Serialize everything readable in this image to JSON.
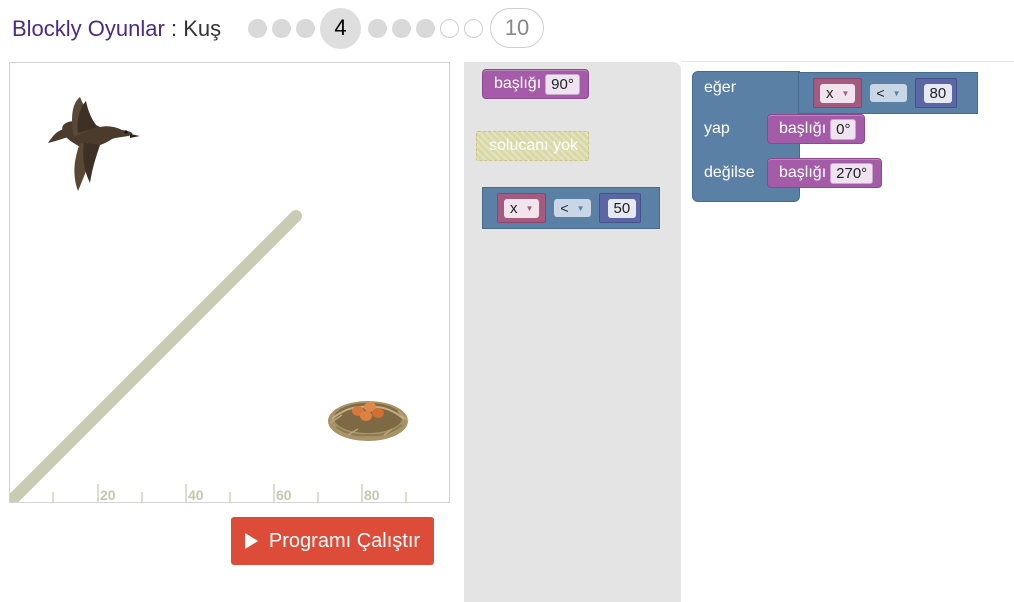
{
  "header": {
    "brand": "Blockly Oyunlar",
    "separator": " : ",
    "game": "Kuş",
    "current_level": "4",
    "max_level": "10"
  },
  "visualization": {
    "ticks": [
      "20",
      "40",
      "60",
      "80"
    ],
    "bird_icon": "bird-image",
    "nest_icon": "nest-with-eggs-image"
  },
  "run_button": {
    "label": "Programı Çalıştır",
    "icon": "play-icon"
  },
  "toolbox": {
    "heading_label": "başlığı",
    "heading_value": "90°",
    "nowall_label": "solucanı yok",
    "compare_var": "x",
    "compare_op": "<",
    "compare_value": "50"
  },
  "workspace": {
    "if_label": "eğer",
    "do_label": "yap",
    "else_label": "değilse",
    "cond_var": "x",
    "cond_op": "<",
    "cond_value": "80",
    "do_heading_label": "başlığı",
    "do_heading_value": "0°",
    "else_heading_label": "başlığı",
    "else_heading_value": "270°"
  },
  "colors": {
    "brand": "#4b2b86",
    "run_button": "#dd4b39",
    "heading_block": "#a55ca8",
    "logic_block": "#5b80a5",
    "number_block": "#5b67a5",
    "variable_block": "#a55b80",
    "wall": "#c9cbb3"
  }
}
